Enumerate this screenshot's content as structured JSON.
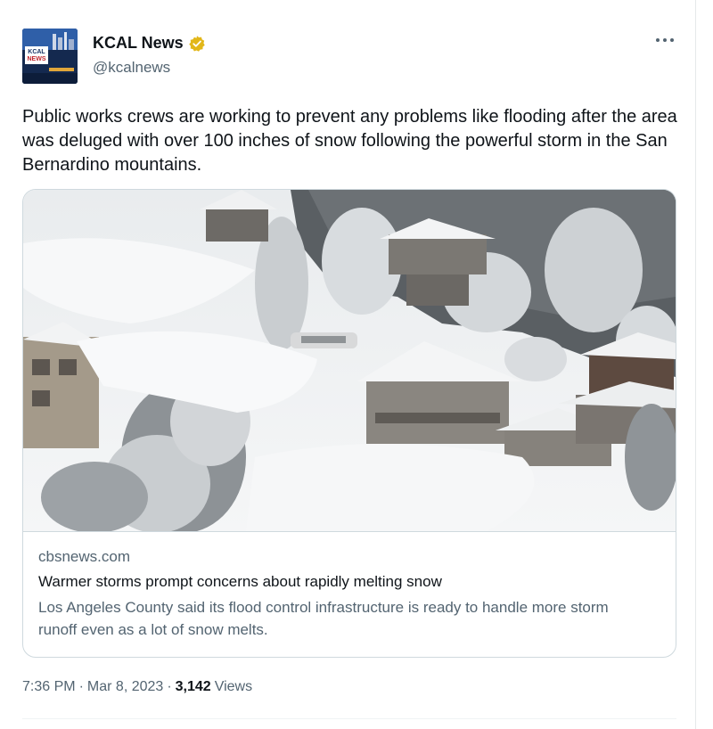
{
  "author": {
    "name": "KCAL News",
    "handle": "@kcalnews",
    "avatar_text": "KCAL NEWS",
    "verified_color": "#e2b719"
  },
  "tweet": {
    "text": "Public works crews are working to prevent any problems like flooding after the area was deluged with over 100 inches of snow following the powerful storm in the San Bernardino mountains."
  },
  "card": {
    "domain": "cbsnews.com",
    "title": "Warmer storms prompt concerns about rapidly melting snow",
    "description": "Los Angeles County said its flood control infrastructure is ready to handle more storm runoff even as a lot of snow melts."
  },
  "meta": {
    "time": "7:36 PM",
    "separator_1": "·",
    "date": "Mar 8, 2023",
    "separator_2": "·",
    "views_count": "3,142",
    "views_label": "Views"
  },
  "colors": {
    "text_primary": "#0f1419",
    "text_secondary": "#536471",
    "border": "#cfd9de"
  },
  "icons": {
    "more": "more-horizontal-icon",
    "verified": "verified-badge-icon"
  }
}
